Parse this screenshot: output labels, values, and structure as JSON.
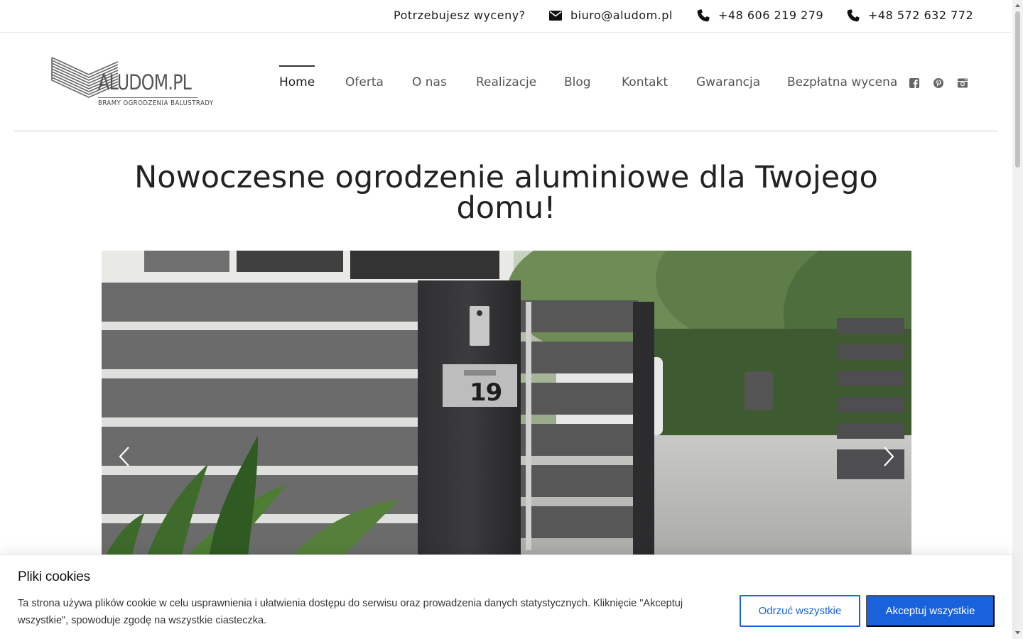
{
  "topbar": {
    "quote_question": "Potrzebujesz wyceny?",
    "email": "biuro@aludom.pl",
    "phone1": "+48 606 219 279",
    "phone2": "+48 572 632 772",
    "icons": [
      "envelope-icon",
      "phone-icon",
      "phone-icon"
    ]
  },
  "logo": {
    "name": "ALUDOM.PL",
    "tagline": "BRAMY OGRODZENIA BALUSTRADY"
  },
  "nav": {
    "items": [
      {
        "label": "Home",
        "active": true
      },
      {
        "label": "Oferta",
        "active": false
      },
      {
        "label": "O nas",
        "active": false
      },
      {
        "label": "Realizacje",
        "active": false
      },
      {
        "label": "Blog",
        "active": false
      },
      {
        "label": "Kontakt",
        "active": false
      },
      {
        "label": "Gwarancja",
        "active": false
      },
      {
        "label": "Bezpłatna wycena",
        "active": false
      }
    ],
    "social_icons": [
      "facebook-icon",
      "pinterest-icon",
      "instagram-icon"
    ]
  },
  "hero": {
    "title_line1": "Nowoczesne ogrodzenie aluminiowe dla Twojego",
    "title_line2": "domu!",
    "slide_house_number": "19",
    "arrows": [
      "chevron-left-icon",
      "chevron-right-icon"
    ]
  },
  "cookie_banner": {
    "title": "Pliki cookies",
    "text": " Ta strona używa plików cookie w celu usprawnienia i ułatwienia dostępu do serwisu oraz prowadzenia danych statystycznych. Kliknięcie \"Akceptuj wszystkie\", spowoduje zgodę na wszystkie ciasteczka.",
    "reject_label": "Odrzuć wszystkie",
    "accept_label": "Akceptuj wszystkie"
  },
  "colors": {
    "accent_blue": "#1863dc",
    "text_dark": "#222222",
    "nav_gray": "#555555"
  }
}
